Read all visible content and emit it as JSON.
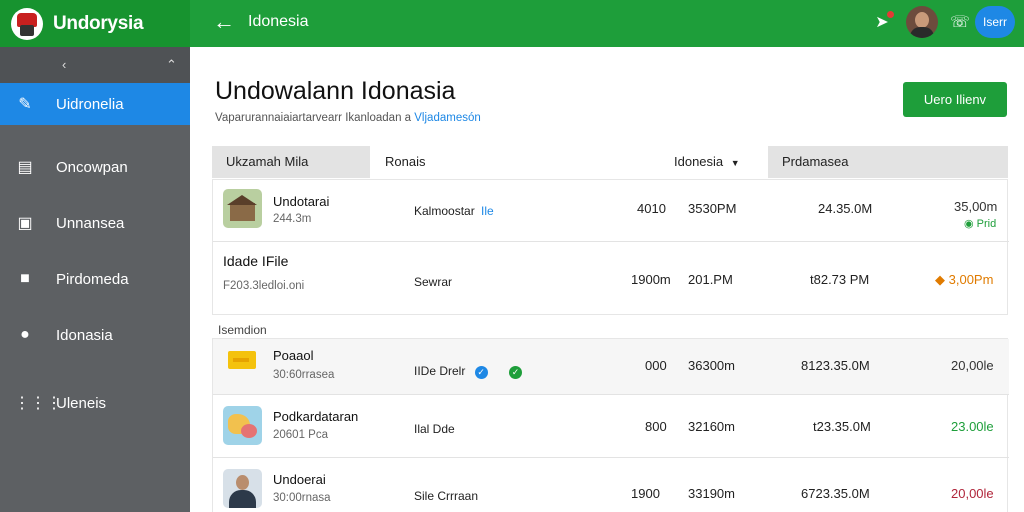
{
  "app": {
    "brand": "Undorysia",
    "top_title": "Idonesia",
    "cta_label": "Uero Ilienv",
    "pill_label": "Iserr"
  },
  "sidebar": {
    "items": [
      {
        "label": "Uidronelia",
        "icon": "edit-icon"
      },
      {
        "label": "Oncowpan",
        "icon": "clipboard-icon"
      },
      {
        "label": "Unnansea",
        "icon": "folder-icon"
      },
      {
        "label": "Pirdomeda",
        "icon": "building-icon"
      },
      {
        "label": "Idonasia",
        "icon": "chat-icon"
      },
      {
        "label": "Uleneis",
        "icon": "grid-icon"
      }
    ]
  },
  "page": {
    "title": "Undowalann Idonasia",
    "subtitle": "Vaparurannaiaiartarvearr Ikanloadan a",
    "subtitle_link": "Vljadamesón"
  },
  "table": {
    "headers": {
      "h1": "Ukzamah Mila",
      "h2": "Ronais",
      "h3": "Idonesia",
      "h4": "Prdamasea"
    },
    "group_label": "Isemdion",
    "rows": [
      {
        "name": "Undotarai",
        "sub": "244.3m",
        "seller": "Kalmoostar",
        "seller_tag": "Ile",
        "col_a": "4010",
        "col_b": "3530PM",
        "col_c": "24.35.0M",
        "col_d": "35,00m",
        "badge": "Prid"
      },
      {
        "name": "Idade IFile",
        "sub": "F203.3ledloi.oni",
        "seller": "Sewrar",
        "col_a": "1900m",
        "col_b": "201.PM",
        "col_c": "t82.73 PM",
        "col_d": "3,00Pm"
      },
      {
        "name": "Poaaol",
        "sub": "30:60rrasea",
        "seller": "IIDe Drelr",
        "col_a": "000",
        "col_b": "36300m",
        "col_c": "8123.35.0M",
        "col_d": "20,00le"
      },
      {
        "name": "Podkardataran",
        "sub": "20601 Pca",
        "seller": "Ilal Dde",
        "col_a": "800",
        "col_b": "32160m",
        "col_c": "t23.35.0M",
        "col_d": "23.00le"
      },
      {
        "name": "Undoerai",
        "sub": "30:00rnasa",
        "seller": "Sile Crrraan",
        "col_a": "1900",
        "col_b": "33190m",
        "col_c": "6723.35.0M",
        "col_d": "20,00le"
      }
    ]
  },
  "colors": {
    "primary_green": "#1e9e3a",
    "accent_blue": "#1e88e5",
    "value_green": "#1e9e3a",
    "value_orange": "#e07b00",
    "value_dark": "#333333",
    "value_red": "#b0253a"
  }
}
